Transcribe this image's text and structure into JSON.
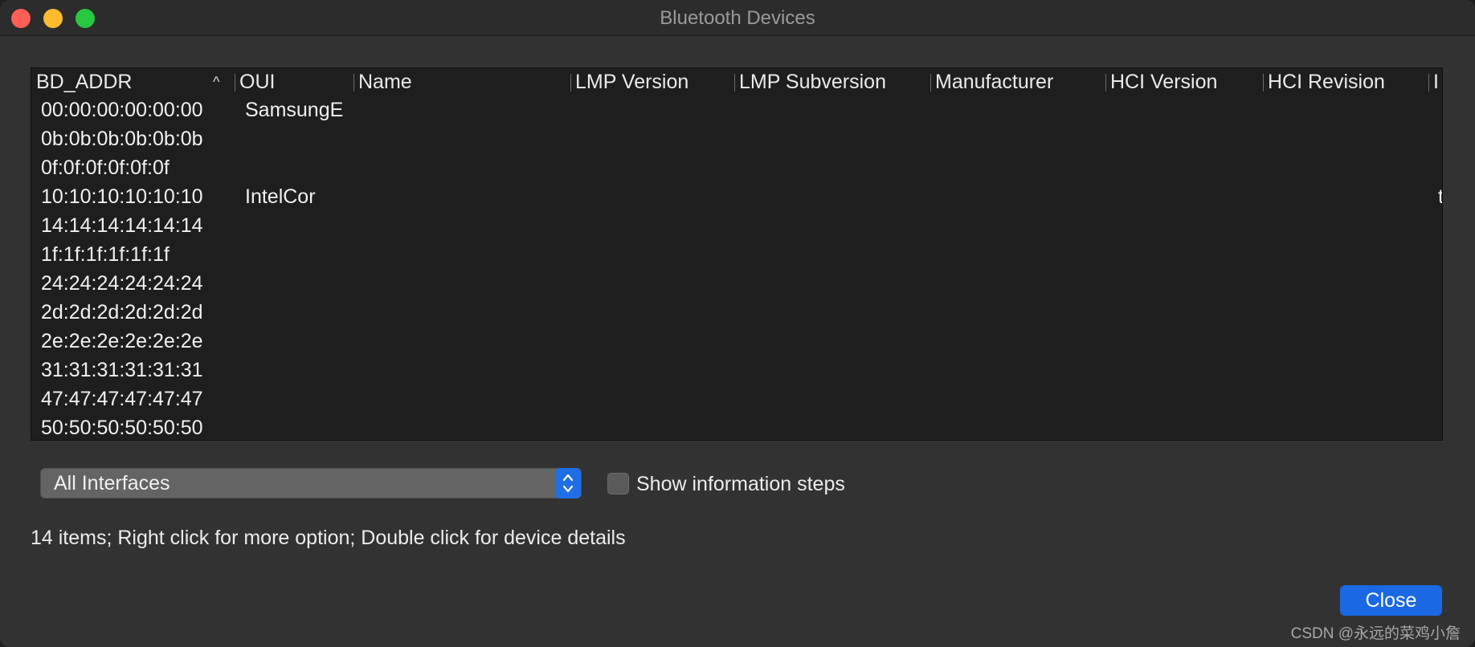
{
  "window": {
    "title": "Bluetooth Devices"
  },
  "table": {
    "columns": [
      {
        "key": "bd_addr",
        "label": "BD_ADDR"
      },
      {
        "key": "oui",
        "label": "OUI"
      },
      {
        "key": "name",
        "label": "Name"
      },
      {
        "key": "lmp_version",
        "label": "LMP Version"
      },
      {
        "key": "lmp_subversion",
        "label": "LMP Subversion"
      },
      {
        "key": "manufacturer",
        "label": "Manufacturer"
      },
      {
        "key": "hci_version",
        "label": "HCI Version"
      },
      {
        "key": "hci_revision",
        "label": "HCI Revision"
      },
      {
        "key": "extra",
        "label": "I"
      }
    ],
    "sort_indicator": "^",
    "rows": [
      {
        "bd_addr": "00:00:00:00:00:00",
        "oui": "SamsungE",
        "extra": ""
      },
      {
        "bd_addr": "0b:0b:0b:0b:0b:0b",
        "oui": "",
        "extra": ""
      },
      {
        "bd_addr": "0f:0f:0f:0f:0f:0f",
        "oui": "",
        "extra": ""
      },
      {
        "bd_addr": "10:10:10:10:10:10",
        "oui": "IntelCor",
        "extra": "t"
      },
      {
        "bd_addr": "14:14:14:14:14:14",
        "oui": "",
        "extra": ""
      },
      {
        "bd_addr": "1f:1f:1f:1f:1f:1f",
        "oui": "",
        "extra": ""
      },
      {
        "bd_addr": "24:24:24:24:24:24",
        "oui": "",
        "extra": ""
      },
      {
        "bd_addr": "2d:2d:2d:2d:2d:2d",
        "oui": "",
        "extra": ""
      },
      {
        "bd_addr": "2e:2e:2e:2e:2e:2e",
        "oui": "",
        "extra": ""
      },
      {
        "bd_addr": "31:31:31:31:31:31",
        "oui": "",
        "extra": ""
      },
      {
        "bd_addr": "47:47:47:47:47:47",
        "oui": "",
        "extra": ""
      },
      {
        "bd_addr": "50:50:50:50:50:50",
        "oui": "",
        "extra": ""
      }
    ]
  },
  "interface_select": {
    "value": "All Interfaces",
    "icon": "chevron-up-down-icon"
  },
  "show_steps": {
    "label": "Show information steps",
    "checked": false
  },
  "status": "14 items; Right click for more option; Double click for device details",
  "close_label": "Close",
  "watermark": "CSDN @永远的菜鸡小詹",
  "colors": {
    "accent": "#1a68e4",
    "background": "#323232",
    "table_bg": "#1e1e1e"
  }
}
